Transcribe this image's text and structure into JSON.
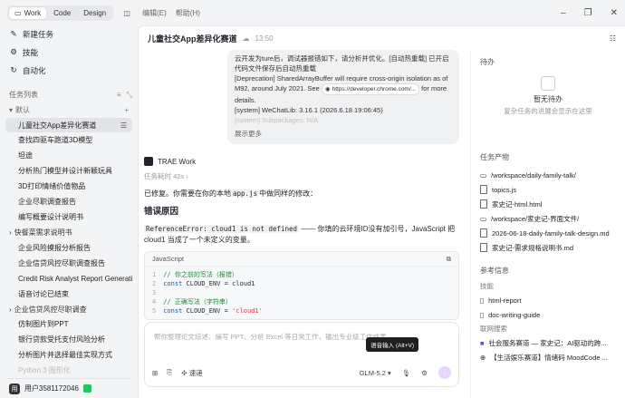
{
  "topbar": {
    "modes": [
      "Work",
      "Code",
      "Design"
    ],
    "active_mode": "Work",
    "menus": [
      "编辑(E)",
      "帮助(H)"
    ]
  },
  "sidebar": {
    "nav": [
      {
        "label": "新建任务",
        "icon": "edit-icon"
      },
      {
        "label": "技能",
        "icon": "skill-icon"
      },
      {
        "label": "自动化",
        "icon": "automation-icon"
      }
    ],
    "task_list_label": "任务列表",
    "default_group": "默认",
    "tasks": [
      "儿童社交App差异化赛道",
      "查找四驱车跑道3D模型",
      "坦途",
      "分析热门模型并设计新颖玩具",
      "3D打印情绪价值物品",
      "企业尽职调查报告",
      "编写概要设计说明书"
    ],
    "group2": "快餐菜需求说明书",
    "tasks2": [
      "企业风险摸报分析报告",
      "企业信贷风控尽职调查报告",
      "Credit Risk Analyst Report Generation",
      "语音讨论已结束"
    ],
    "group3": "企业信贷风控尽职调查",
    "tasks3": [
      "仿制图片到PPT",
      "银行贷款受托支付风险分析",
      "分析图片并选择最佳实现方式",
      "Python 3 图形化"
    ],
    "user": "用户3581172046"
  },
  "main": {
    "title": "儿童社交App差异化赛道",
    "time": "13:50",
    "log": {
      "line1": "云开发为ture后，调试器报错如下，请分析并优化。[自动热重载] 已开启代码文件保存后自动热重载",
      "line2a": "[Deprecation] SharedArrayBuffer will require cross-origin isolation as of M92, around July 2021. See",
      "chip": "https://developer.chrome.com/...",
      "line2b": "for more details.",
      "line3": "[system] WeChatLib: 3.16.1 (2026.6.18 19:06:45)",
      "line4": "[system] Subpackages: N/A",
      "more": "展示更多"
    },
    "agent": "TRAE Work",
    "elapsed": "任务耗时 42s",
    "fixed_pre": "已修复。你需要在你的本地",
    "fixed_code": "app.js",
    "fixed_post": "中做同样的修改：",
    "cause_title": "错误原因",
    "error_code": "ReferenceError: cloud1 is not defined",
    "error_text": "—— 你填的云环境ID没有加引号，JavaScript 把 cloud1 当成了一个未定义的变量。",
    "code_lang": "JavaScript",
    "code_lines": [
      {
        "n": "1",
        "kind": "comment",
        "text": "// 你之前的写法（报错）"
      },
      {
        "n": "2",
        "kind": "code",
        "kw": "const",
        "rest": "CLOUD_ENV = cloud1"
      },
      {
        "n": "3",
        "kind": "blank",
        "text": ""
      },
      {
        "n": "4",
        "kind": "comment",
        "text": "// 正确写法（字符串）"
      },
      {
        "n": "5",
        "kind": "string",
        "kw": "const",
        "rest": "CLOUD_ENV = ",
        "str": "'cloud1'"
      }
    ],
    "composer_placeholder": "帮你整理论文综述、编写 PPT、分析 Excel 等日常工作，输出专业级工作成果。",
    "speed": "速递",
    "model": "GLM-5.2",
    "tooltip": "语音输入 (Alt+V)"
  },
  "right": {
    "todo_title": "待办",
    "empty_title": "暂无待办",
    "empty_sub": "复杂任务的进展会显示在这里",
    "outputs_title": "任务产物",
    "outputs": [
      "/workspace/daily-family-talk/",
      "topics.js",
      "家史记-html.html",
      "/workspace/家史记-界面文件/",
      "2026-06-18-daily-family-talk-design.md",
      "家史记-需求规格说明书.md"
    ],
    "ref_title": "参考信息",
    "skills_title": "技能",
    "skills": [
      "html-report",
      "doc-writing-guide"
    ],
    "search_title": "联网搜索",
    "search": [
      "社会服务赛道 — 家史记：AI驱动的跨...",
      "【生活娱乐赛道】情绪码 MoodCode ..."
    ]
  },
  "colors": {
    "accent": "#7c3aed",
    "bg": "#f3f4f6",
    "panel": "#ffffff"
  }
}
